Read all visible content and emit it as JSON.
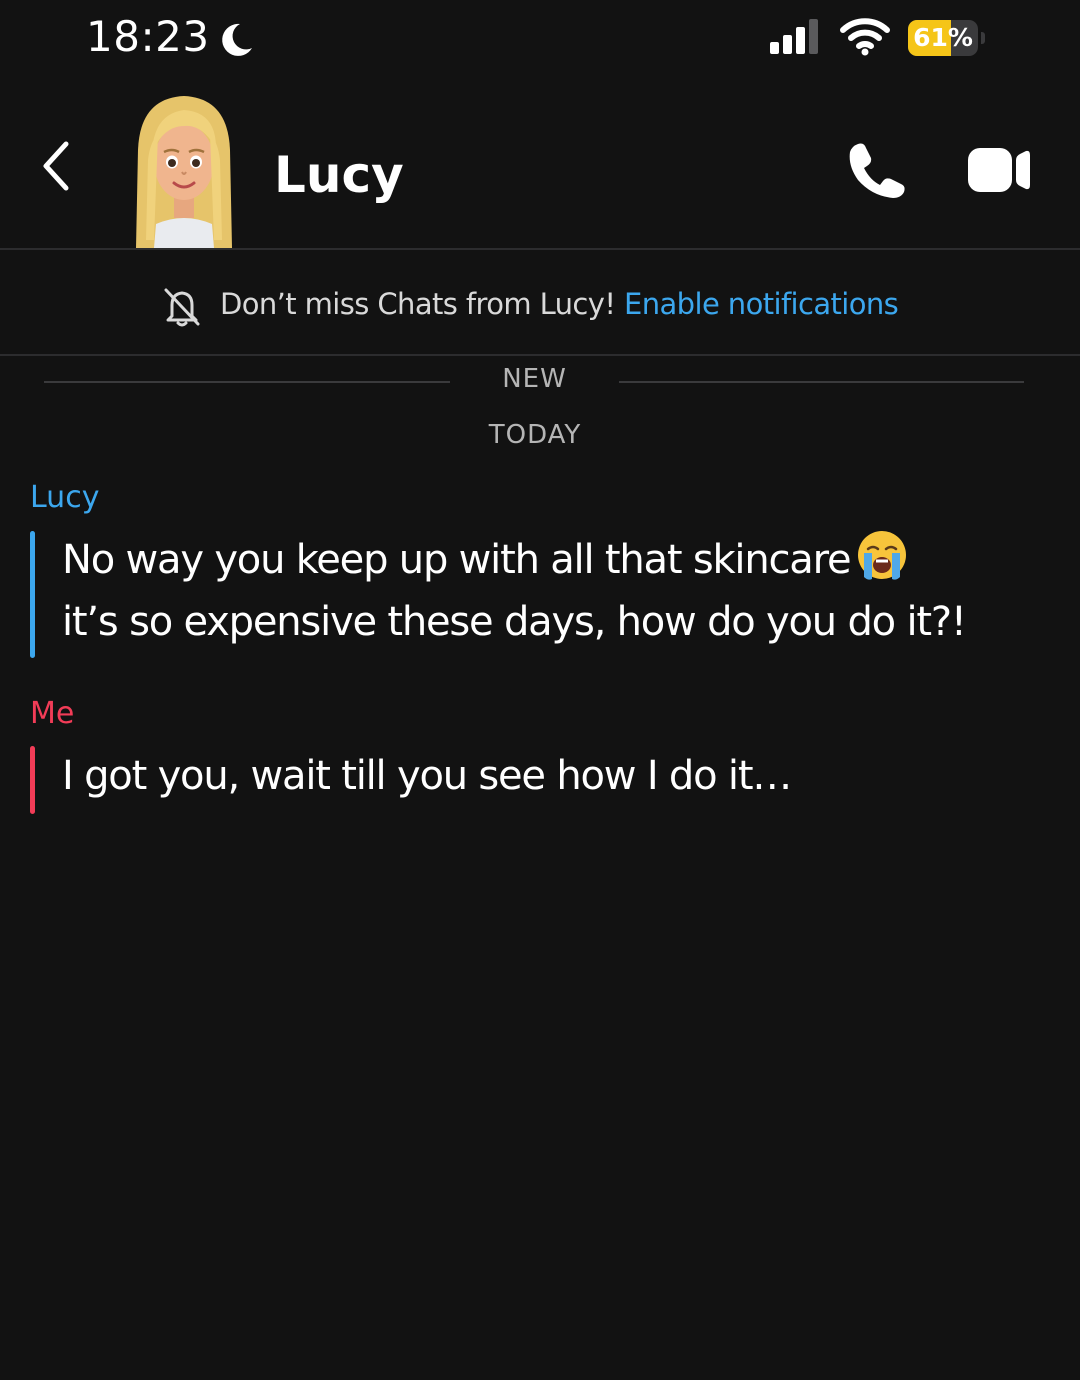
{
  "status_bar": {
    "time": "18:23",
    "battery_percent": "61%",
    "battery_level": 0.61,
    "icons": [
      "moon-icon",
      "signal-icon",
      "wifi-icon",
      "battery-icon"
    ]
  },
  "header": {
    "contact_name": "Lucy",
    "icons": [
      "chevron-left-icon",
      "avatar",
      "phone-icon",
      "video-camera-icon"
    ]
  },
  "banner": {
    "text": "Don’t miss Chats from Lucy!",
    "link": "Enable notifications"
  },
  "dividers": {
    "new": "NEW",
    "today": "TODAY"
  },
  "messages": [
    {
      "sender": "Lucy",
      "lines": [
        "No way you keep up with all that skincare",
        "it’s so expensive these days, how do you do it?!"
      ],
      "emoji": "loudly-crying-face-icon"
    },
    {
      "sender": "Me",
      "lines": [
        "I got you, wait till you see how I do it…"
      ]
    }
  ],
  "colors": {
    "background": "#121212",
    "lucy_accent": "#3ca7ee",
    "me_accent": "#f23c57",
    "battery": "#f5c518"
  }
}
